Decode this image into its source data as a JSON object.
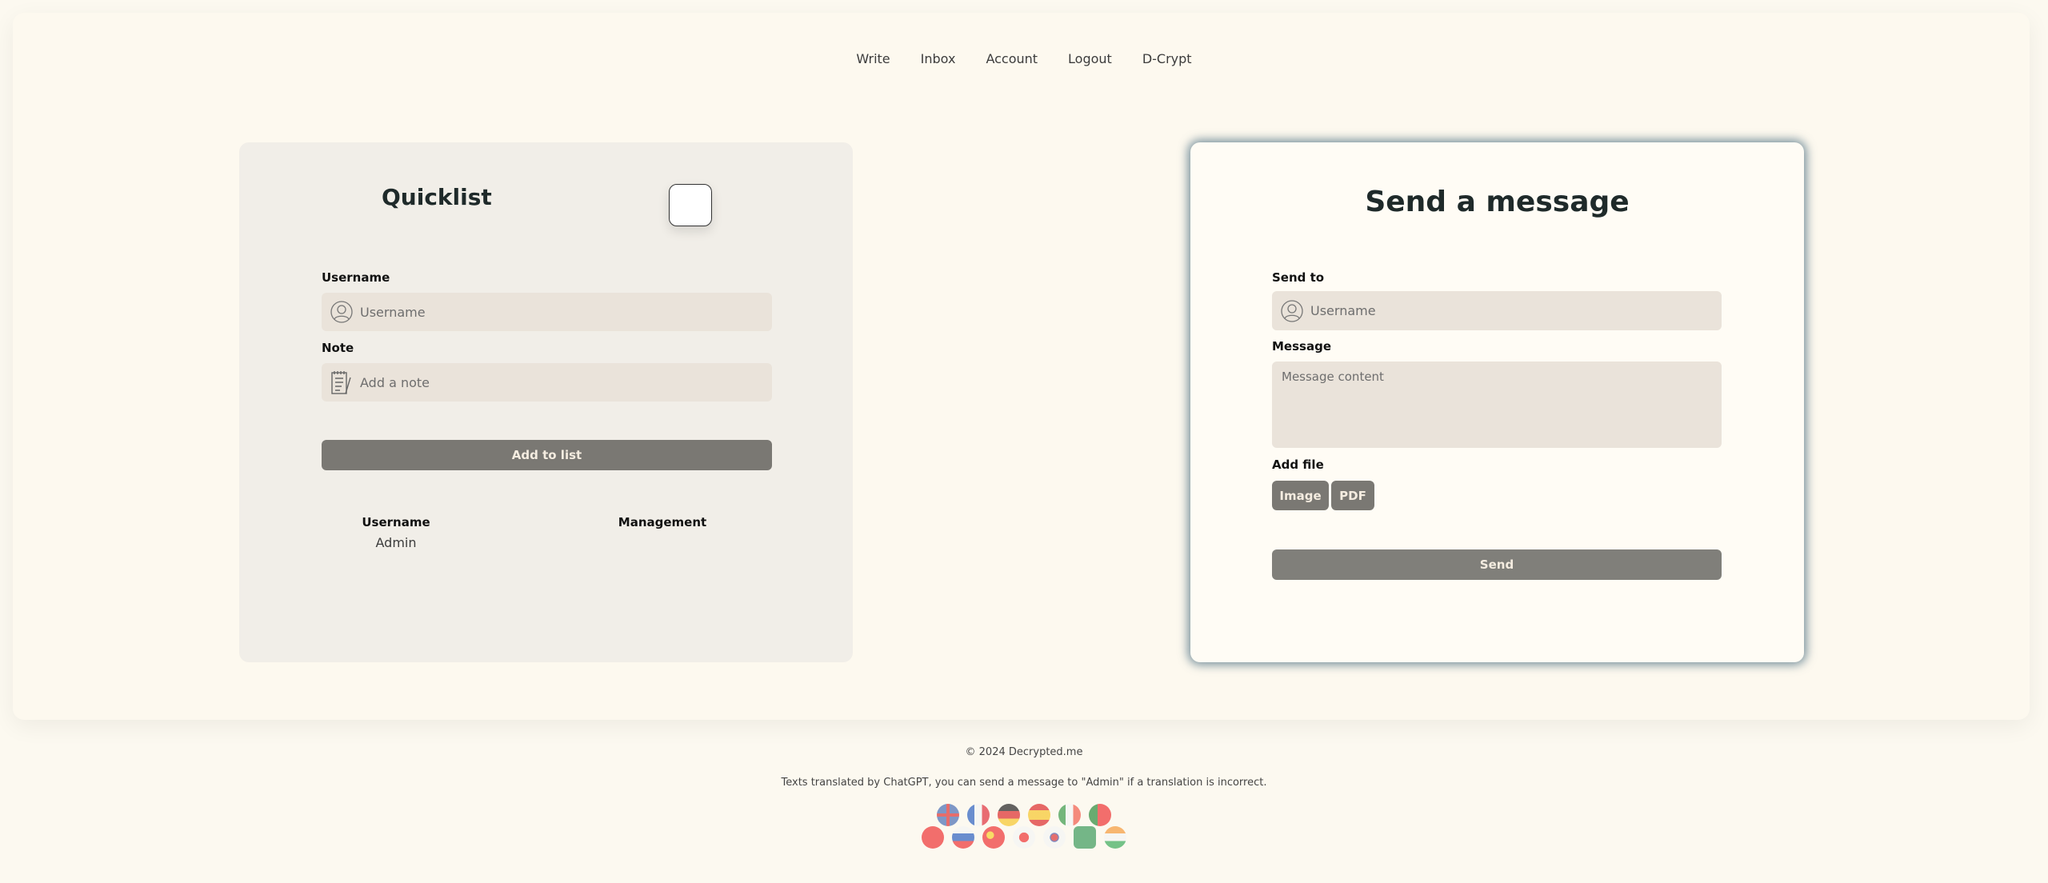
{
  "nav": {
    "items": [
      "Write",
      "Inbox",
      "Account",
      "Logout",
      "D-Crypt"
    ]
  },
  "quicklist": {
    "title": "Quicklist",
    "username_label": "Username",
    "username_placeholder": "Username",
    "note_label": "Note",
    "note_placeholder": "Add a note",
    "add_button": "Add to list",
    "table": {
      "headers": [
        "Username",
        "Management"
      ],
      "rows": [
        [
          "Admin",
          ""
        ]
      ]
    }
  },
  "send": {
    "title": "Send a message",
    "to_label": "Send to",
    "to_placeholder": "Username",
    "message_label": "Message",
    "message_placeholder": "Message content",
    "file_label": "Add file",
    "image_button": "Image",
    "pdf_button": "PDF",
    "send_button": "Send"
  },
  "footer": {
    "copyright": "© 2024 Decrypted.me",
    "translation_note": "Texts translated by ChatGPT, you can send a message to \"Admin\" if a translation is incorrect.",
    "languages_row1": [
      "english-flag",
      "french-flag",
      "german-flag",
      "spanish-flag",
      "italian-flag",
      "portuguese-flag"
    ],
    "languages_row2": [
      "turkish-flag",
      "russian-flag",
      "chinese-flag",
      "japanese-flag",
      "korean-flag",
      "arabic-flag",
      "indian-flag"
    ]
  },
  "colors": {
    "button": "#7a7873",
    "input": "#eae3da",
    "card_shadow": "#46697d"
  }
}
